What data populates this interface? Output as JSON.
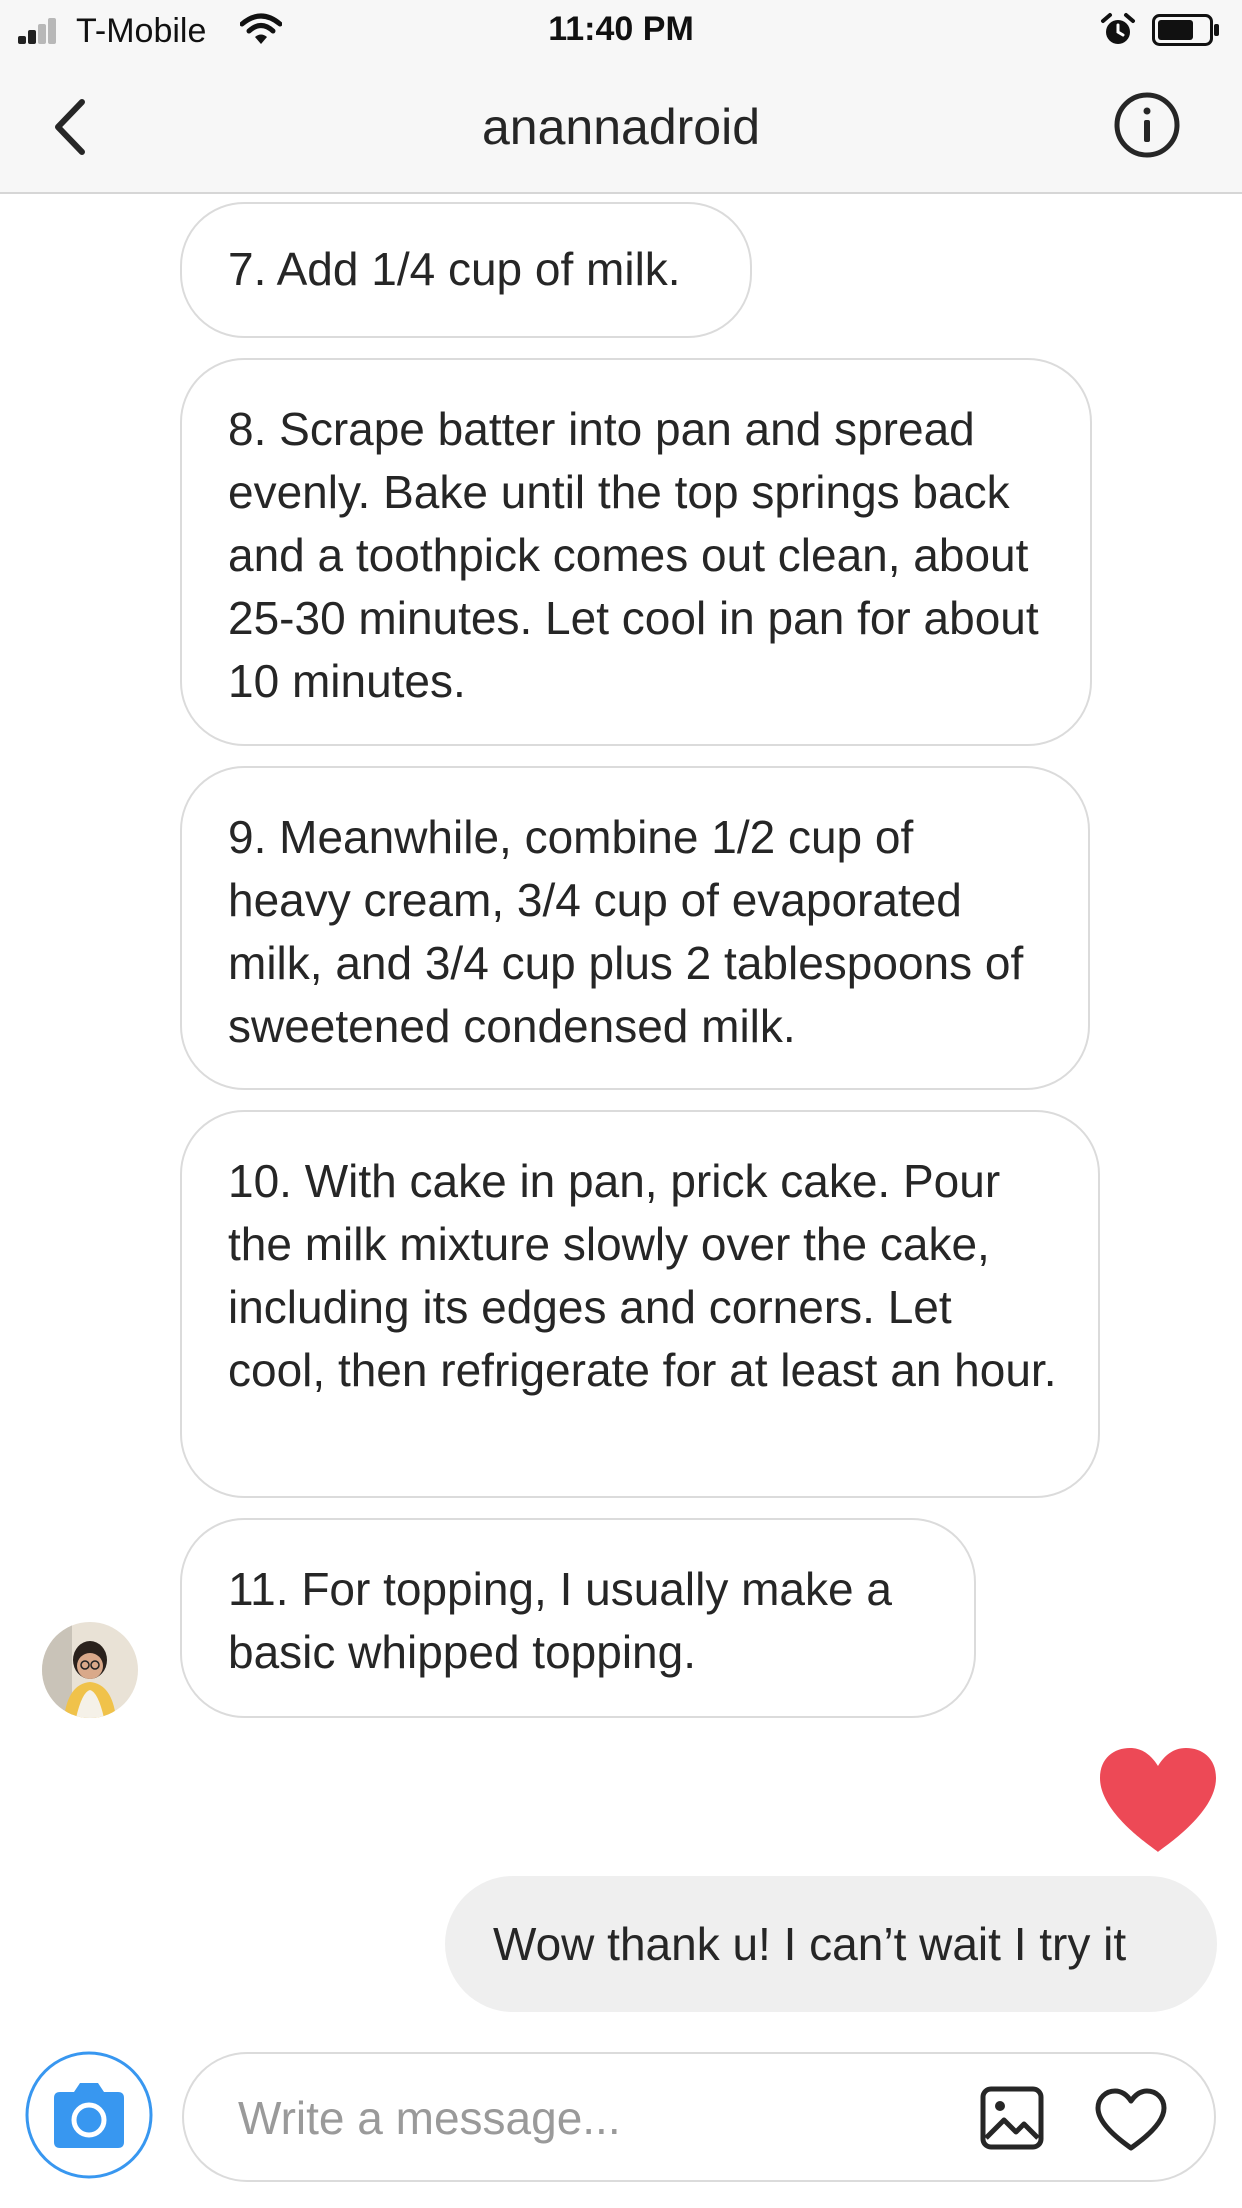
{
  "status_bar": {
    "carrier": "T-Mobile",
    "time": "11:40 PM",
    "signal_bars": 2,
    "battery_level": 0.7
  },
  "header": {
    "title": "anannadroid",
    "back_icon": "chevron-left-icon",
    "info_icon": "info-icon"
  },
  "messages": [
    {
      "text": "7. Add 1/4 cup of milk."
    },
    {
      "text": "8. Scrape batter into pan and spread evenly. Bake until the top springs back and a toothpick comes out clean, about 25-30 minutes. Let cool in pan for about 10 minutes."
    },
    {
      "text": "9. Meanwhile, combine 1/2 cup of heavy cream, 3/4 cup of evaporated milk, and 3/4 cup plus 2 tablespoons of sweetened condensed milk."
    },
    {
      "text": "10. With cake in pan, prick cake. Pour the milk mixture slowly over the cake, including its edges and corners. Let cool, then refrigerate for at least an hour."
    },
    {
      "text": "11. For topping, I usually make a basic whipped topping."
    }
  ],
  "reaction_icon": "heart-icon",
  "sent_message": {
    "text": "Wow thank u! I can’t wait I try it"
  },
  "composer": {
    "placeholder": "Write a message...",
    "value": ""
  },
  "colors": {
    "like_red": "#ed4956",
    "camera_blue": "#3897f0",
    "bubble_border": "#dbdbdb",
    "sent_bubble": "#efefef"
  }
}
